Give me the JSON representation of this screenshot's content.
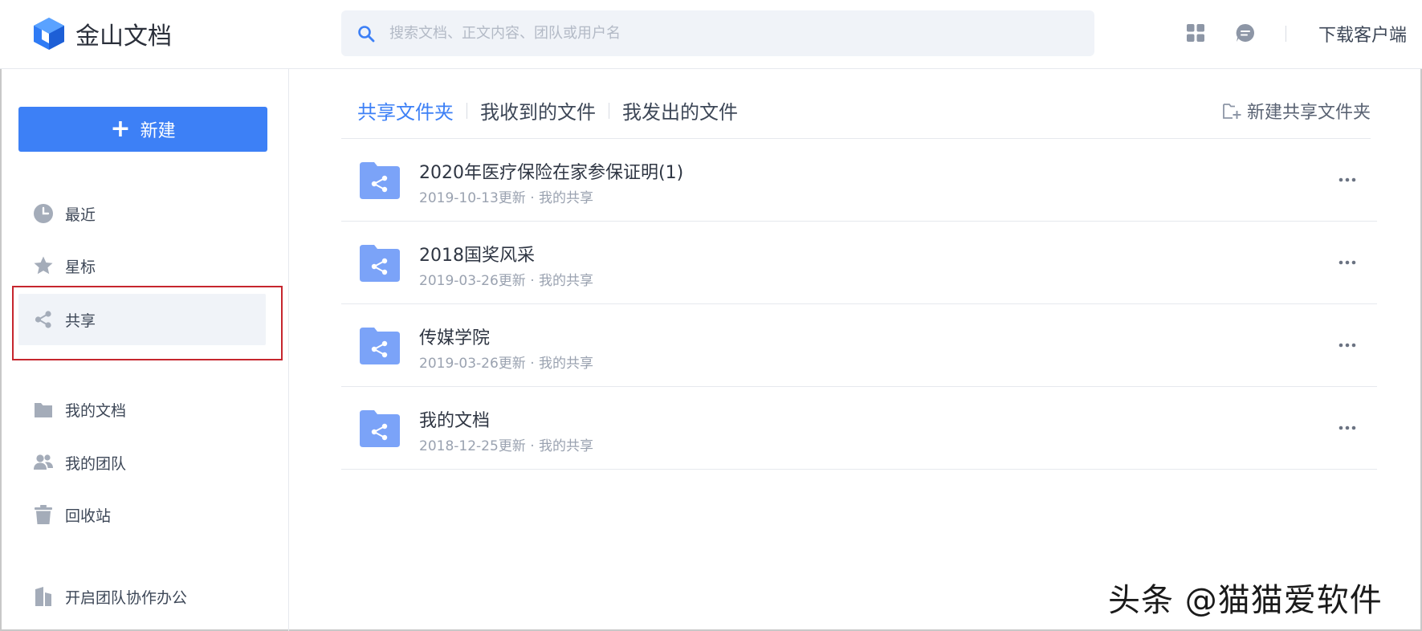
{
  "app": {
    "name": "金山文档"
  },
  "search": {
    "placeholder": "搜索文档、正文内容、团队或用户名"
  },
  "header": {
    "download_label": "下载客户端"
  },
  "sidebar": {
    "new_button_label": "新建",
    "items": [
      {
        "label": "最近",
        "icon": "clock-icon"
      },
      {
        "label": "星标",
        "icon": "star-icon"
      },
      {
        "label": "共享",
        "icon": "share-icon",
        "active": true
      },
      {
        "label": "我的文档",
        "icon": "folder-icon"
      },
      {
        "label": "我的团队",
        "icon": "team-icon"
      },
      {
        "label": "回收站",
        "icon": "trash-icon"
      },
      {
        "label": "开启团队协作办公",
        "icon": "office-icon"
      }
    ]
  },
  "main": {
    "tabs": [
      {
        "label": "共享文件夹",
        "active": true
      },
      {
        "label": "我收到的文件"
      },
      {
        "label": "我发出的文件"
      }
    ],
    "new_shared_folder_label": "新建共享文件夹",
    "files": [
      {
        "title": "2020年医疗保险在家参保证明(1)",
        "meta": "2019-10-13更新 · 我的共享"
      },
      {
        "title": "2018国奖风采",
        "meta": "2019-03-26更新 · 我的共享"
      },
      {
        "title": "传媒学院",
        "meta": "2019-03-26更新 · 我的共享"
      },
      {
        "title": "我的文档",
        "meta": "2018-12-25更新 · 我的共享"
      }
    ]
  },
  "watermark": "头条 @猫猫爱软件",
  "colors": {
    "accent": "#3d80f6",
    "folder": "#7ba3f8",
    "highlight_border": "#c6262e",
    "active_bg": "#f0f3f8"
  }
}
